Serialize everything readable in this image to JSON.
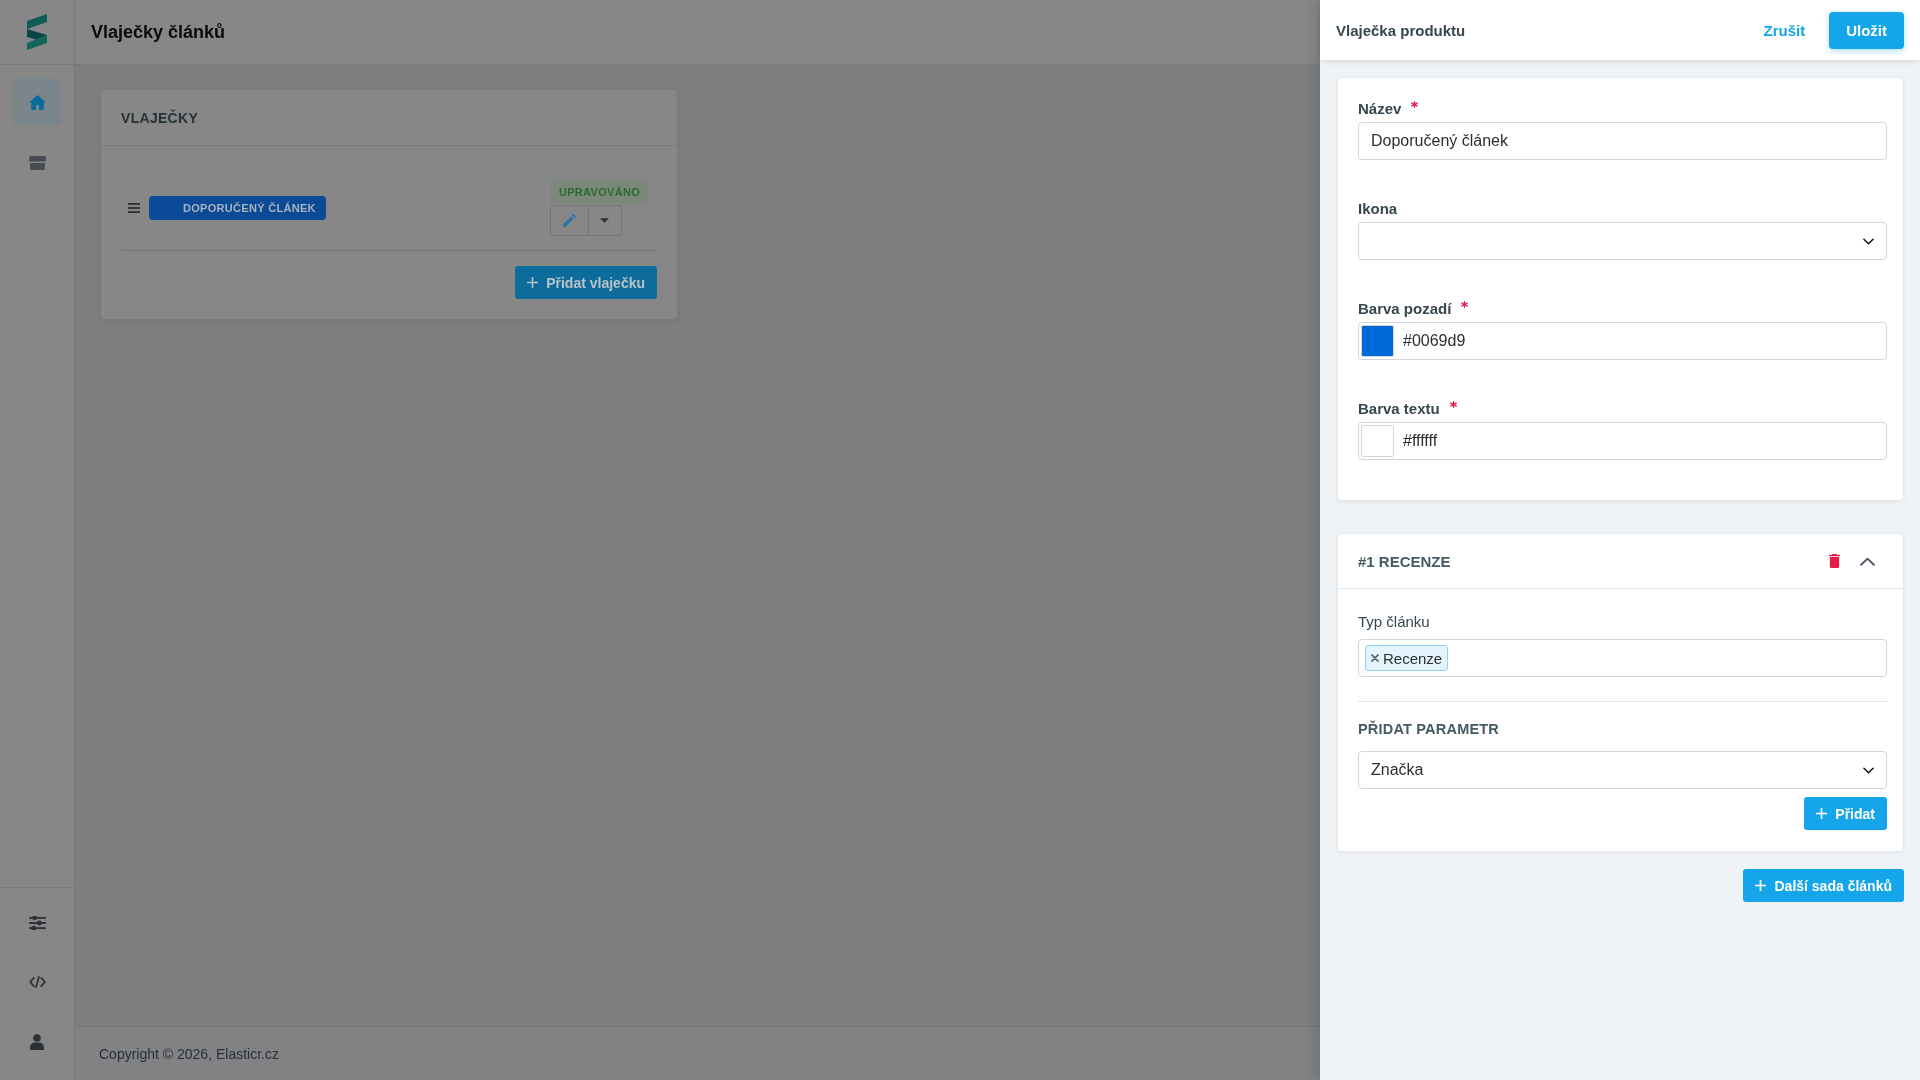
{
  "header": {
    "title": "Vlaječky článků"
  },
  "sidebar": {
    "items": [
      {
        "selected": true
      },
      {
        "selected": false
      }
    ]
  },
  "flags_card": {
    "title": "VLAJEČKY",
    "flags": [
      {
        "label": "DOPORUČENÝ ČLÁNEK",
        "color": "#0a4a96",
        "status": "UPRAVOVÁNO"
      }
    ],
    "add_button": "Přidat vlaječku"
  },
  "footer": {
    "copyright": "Copyright © 2026, Elasticr.cz"
  },
  "panel": {
    "title": "Vlaječka produktu",
    "cancel": "Zrušit",
    "save": "Uložit",
    "fields": [
      {
        "kind": "text",
        "label": "Název",
        "required": true,
        "value": "Doporučený článek"
      },
      {
        "kind": "select",
        "label": "Ikona",
        "required": false
      },
      {
        "kind": "color",
        "label": "Barva pozadí",
        "required": true,
        "value": "#0069d9"
      },
      {
        "kind": "color",
        "label": "Barva textu",
        "required": true,
        "value": "#ffffff"
      }
    ],
    "article_sets": [
      {
        "title": "#1 RECENZE",
        "expanded": true,
        "type_label": "Typ článku",
        "tags": [
          "Recenze"
        ],
        "param_heading": "PŘIDAT PARAMETR",
        "param_select": "Značka",
        "add_button": "Přidat"
      }
    ],
    "add_set_button": "Další sada článků"
  }
}
